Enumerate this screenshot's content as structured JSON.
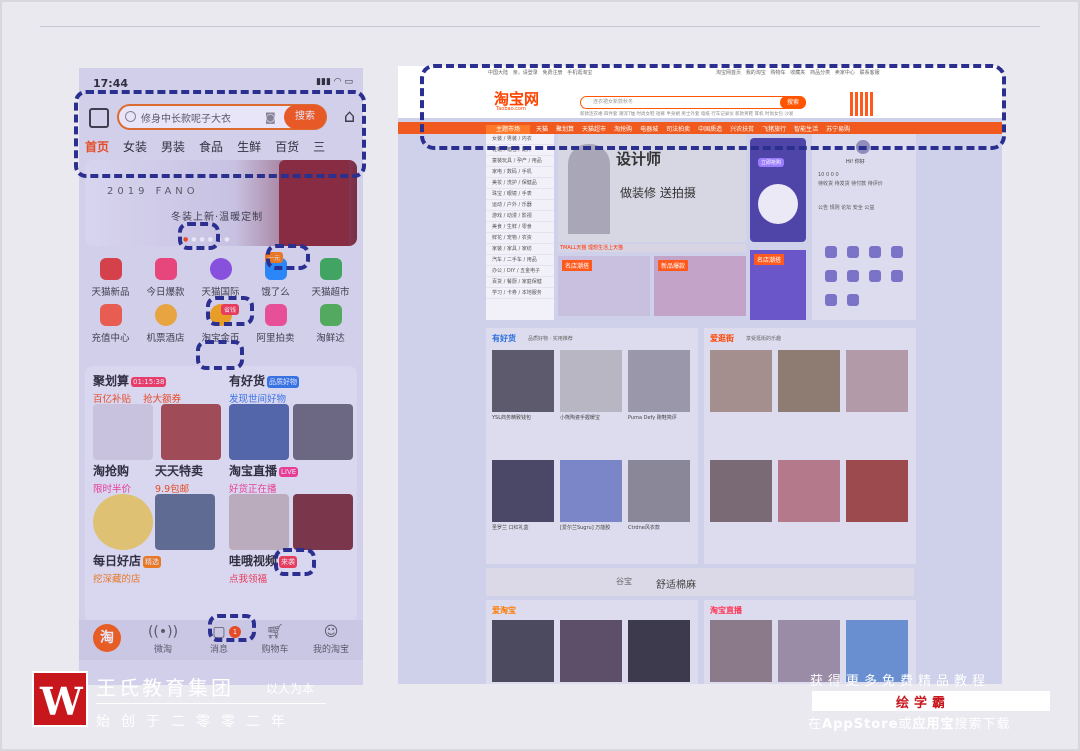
{
  "phone": {
    "time": "17:44",
    "search_placeholder": "修身中长款呢子大衣",
    "search_button": "搜索",
    "categories": [
      "首页",
      "女装",
      "男装",
      "食品",
      "生鲜",
      "百货",
      "三"
    ],
    "banner_year": "2019  FANO",
    "banner_tagline": "冬装上新·温暖定制",
    "grid": [
      {
        "label": "天猫新品",
        "color": "#e8372e"
      },
      {
        "label": "今日爆款",
        "color": "#ff3d6b"
      },
      {
        "label": "天猫国际",
        "color": "#8a4be0"
      },
      {
        "label": "饿了么",
        "color": "#1a8cff"
      },
      {
        "label": "天猫超市",
        "color": "#35b04a"
      },
      {
        "label": "充值中心",
        "color": "#ff5a36"
      },
      {
        "label": "机票酒店",
        "color": "#ffb020"
      },
      {
        "label": "淘宝金币",
        "color": "#ffa800"
      },
      {
        "label": "阿里拍卖",
        "color": "#ff4a8b"
      },
      {
        "label": "淘鲜达",
        "color": "#4cb648"
      }
    ],
    "badge_one": "一元",
    "badge_gold": "省钱",
    "cards": [
      {
        "title": "聚划算",
        "subtitle": "百亿补贴",
        "sub2": "抢大额券",
        "sub_color": "#ff4400"
      },
      {
        "title": "有好货",
        "subtitle": "发现世间好物",
        "badge": "品质好物",
        "sub_color": "#2a74e8"
      },
      {
        "title": "淘抢购",
        "subtitle": "限时半价",
        "sub_color": "#ff3388"
      },
      {
        "title": "天天特卖",
        "subtitle": "9.9包邮",
        "sub_color": "#ff4400"
      },
      {
        "title": "淘宝直播",
        "subtitle": "好货正在播",
        "badge": "LIVE",
        "sub_color": "#ff3388"
      },
      {
        "title": "每日好店",
        "subtitle": "挖深藏的店",
        "badge": "精选",
        "sub_color": "#ff7a00"
      },
      {
        "title": "哇哦视频",
        "subtitle": "点我领福",
        "badge": "来袭",
        "sub_color": "#ff3344"
      }
    ],
    "countdown": "01:15:38",
    "tabs": [
      "",
      "微淘",
      "消息",
      "购物车",
      "我的淘宝"
    ],
    "tab_logo": "淘",
    "msg_count": "1"
  },
  "web": {
    "logo": "淘宝网",
    "logo_url": "Taobao.com",
    "search_placeholder": "连衣裙女新款秋冬",
    "search_button": "搜索",
    "hot_words": "新款连衣裙 四件套 潮流T恤 时尚女鞋 短裤 半身裙 男士外套 墙纸 行车记录仪 新款男鞋 耳机 时尚女包 沙发",
    "nav_main": "主题市场",
    "nav_items": [
      "天猫",
      "聚划算",
      "天猫超市",
      "淘抢购",
      "电器城",
      "司法拍卖",
      "中国质造",
      "兴农扶贫",
      "飞猪旅行",
      "智能生活",
      "苏宁易购"
    ],
    "sidebar": [
      "女装 / 男装 / 内衣",
      "鞋靴 / 箱包 / 配件",
      "童装玩具 / 孕产 / 用品",
      "家电 / 数码 / 手机",
      "美妆 / 洗护 / 保健品",
      "珠宝 / 眼镜 / 手表",
      "运动 / 户外 / 乐器",
      "游戏 / 动漫 / 影视",
      "美食 / 生鲜 / 零食",
      "鲜花 / 宠物 / 农资",
      "家装 / 家具 / 家纺",
      "汽车 / 二手车 / 用品",
      "办公 / DIY / 五金电子",
      "百货 / 餐厨 / 家庭保健",
      "学习 / 卡券 / 本地服务"
    ],
    "banner_t1": "设计师",
    "banner_t2": "做装修 送拍摄",
    "side_ad_label": "立即抢购",
    "strip": "TMALL天猫 理想生活上天猫",
    "mini1": "名店潮搭",
    "mini2": "新品爆款",
    "mini3": "名店潮搭",
    "user_greeting": "Hi! 你好",
    "user_row1": "10      0      0      0",
    "user_row2": "待收货  待发货  待付款  待评价",
    "user_row3": "公告  规则  论坛  安全  公益",
    "section1_title": "有好货",
    "section1_sub": "品质好物 · 实用推荐",
    "section2_title": "爱逛街",
    "section2_sub": "享受逛街的乐趣",
    "products1": [
      "YSL商务精致钱包",
      "小熊陶瓷手握暖宝",
      "Puma Defy 跑鞋简评",
      "圣罗兰 口红礼盒",
      "[爱尔兰Sugru] 万能胶",
      "Ctrdne风衣款"
    ],
    "banner2_brand": "谷宝",
    "banner2_text": "舒适棉麻",
    "section3_title": "爱淘宝",
    "section4_title": "淘宝直播"
  },
  "footer": {
    "logo_letter": "W",
    "company": "王氏教育集团",
    "motto": "以人为本",
    "since": "始创于二零零二年",
    "promo_top": "获得更多免费精品教程",
    "promo_brand": "绘学霸",
    "promo_bottom_a": "在",
    "promo_bottom_b": "AppStore",
    "promo_bottom_c": "或",
    "promo_bottom_d": "应用宝",
    "promo_bottom_e": "搜索下载"
  }
}
